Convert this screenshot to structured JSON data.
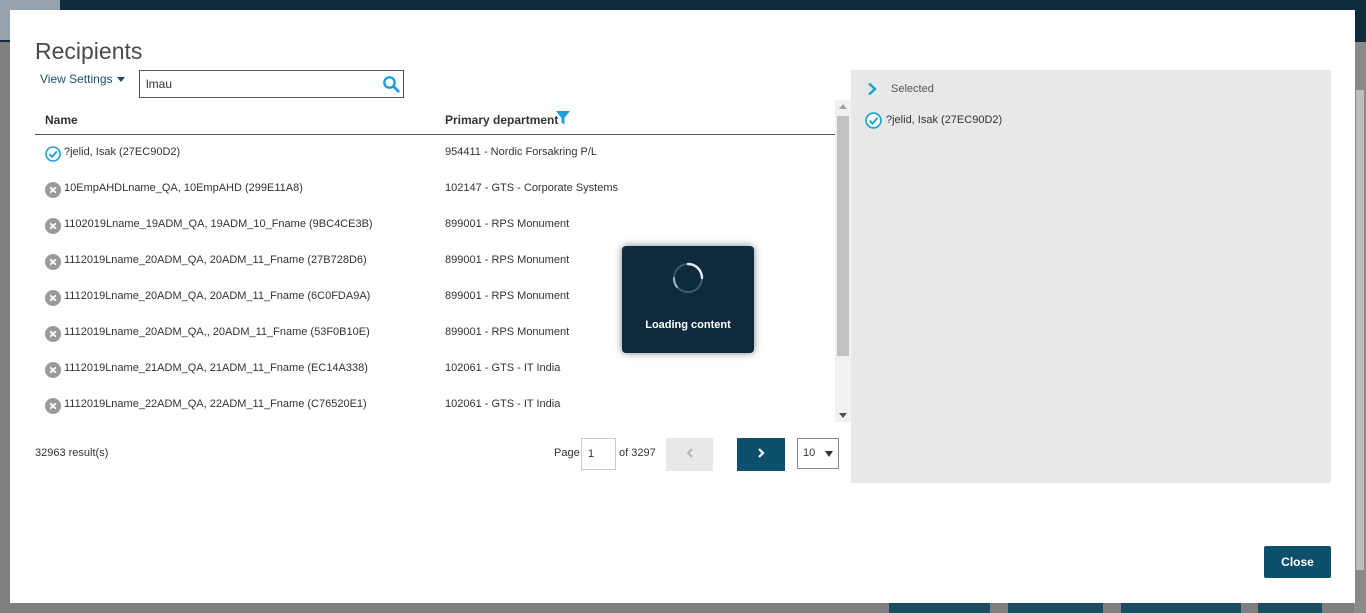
{
  "modal": {
    "title": "Recipients",
    "view_settings_label": "View Settings",
    "search": {
      "value": "lmau"
    },
    "columns": {
      "name": "Name",
      "department": "Primary department"
    },
    "rows": [
      {
        "status": "selected",
        "name": "?jelid, Isak (27EC90D2)",
        "department": "954411 - Nordic Forsakring P/L"
      },
      {
        "status": "unselected",
        "name": "10EmpAHDLname_QA, 10EmpAHD (299E11A8)",
        "department": "102147 - GTS - Corporate Systems"
      },
      {
        "status": "unselected",
        "name": "1102019Lname_19ADM_QA, 19ADM_10_Fname (9BC4CE3B)",
        "department": "899001 - RPS Monument"
      },
      {
        "status": "unselected",
        "name": "1112019Lname_20ADM_QA, 20ADM_11_Fname (27B728D6)",
        "department": "899001 - RPS Monument"
      },
      {
        "status": "unselected",
        "name": "1112019Lname_20ADM_QA, 20ADM_11_Fname (6C0FDA9A)",
        "department": "899001 - RPS Monument"
      },
      {
        "status": "unselected",
        "name": "1112019Lname_20ADM_QA,, 20ADM_11_Fname (53F0B10E)",
        "department": "899001 - RPS Monument"
      },
      {
        "status": "unselected",
        "name": "1112019Lname_21ADM_QA, 21ADM_11_Fname (EC14A338)",
        "department": "102061 - GTS - IT India"
      },
      {
        "status": "unselected",
        "name": "1112019Lname_22ADM_QA, 22ADM_11_Fname (C76520E1)",
        "department": "102061 - GTS - IT India"
      }
    ],
    "pagination": {
      "results_label": "32963 result(s)",
      "page_label": "Page",
      "current_page": "1",
      "of_label": "of 3297",
      "per_page": "10"
    },
    "selected_panel": {
      "title": "Selected",
      "items": [
        {
          "label": "?jelid, Isak (27EC90D2)"
        }
      ]
    },
    "loading": {
      "text": "Loading content"
    },
    "close_label": "Close"
  },
  "colors": {
    "accent": "#1ba1d8",
    "primary_button": "#0e4f6b",
    "overlay": "#0f2a3d",
    "panel_bg": "#e8e8e8"
  }
}
